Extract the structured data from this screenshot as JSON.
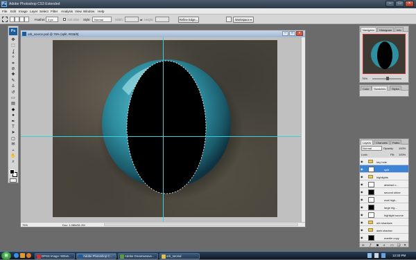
{
  "window": {
    "title": "Adobe Photoshop CS3 Extended",
    "logo": "Ps"
  },
  "menu": [
    "File",
    "Edit",
    "Image",
    "Layer",
    "Select",
    "Filter",
    "Analysis",
    "View",
    "Window",
    "Help"
  ],
  "options": {
    "feather_label": "Feather:",
    "feather_value": "0 px",
    "antialias_label": "Anti-alias",
    "style_label": "Style:",
    "style_value": "Normal",
    "width_label": "Width:",
    "height_label": "Height:",
    "refine_edge": "Refine Edge...",
    "workspace": "Workspace"
  },
  "tools_logo": "Ps",
  "document": {
    "title": "orb_source.psd @ 75% (split, RGB/8)",
    "zoom": "75%",
    "doc_size": "Doc: 1.08M/61.2M"
  },
  "navigator": {
    "tabs": [
      "Navigator",
      "Histogram",
      "Info"
    ],
    "zoom": "75%"
  },
  "color_panel": {
    "tabs": [
      "Color",
      "Swatches",
      "Styles"
    ]
  },
  "layers_panel": {
    "tabs": [
      "Layers",
      "Channels",
      "Paths"
    ],
    "blend_mode": "Normal",
    "opacity_label": "Opacity:",
    "opacity_value": "100%",
    "lock_label": "Lock:",
    "fill_label": "Fill:",
    "fill_value": "100%",
    "layers": [
      {
        "name": "key hole",
        "type": "group"
      },
      {
        "name": "split",
        "type": "layer",
        "selected": true
      },
      {
        "name": "highlights",
        "type": "group"
      },
      {
        "name": "abstract c...",
        "type": "layer"
      },
      {
        "name": "second shine",
        "type": "layer"
      },
      {
        "name": "oval high...",
        "type": "layer"
      },
      {
        "name": "large hig...",
        "type": "layer"
      },
      {
        "name": "highlight source",
        "type": "layer"
      },
      {
        "name": "orb shadows",
        "type": "group"
      },
      {
        "name": "dark shadow",
        "type": "group"
      },
      {
        "name": "marble copy",
        "type": "layer"
      }
    ]
  },
  "taskbar": {
    "items": [
      "DPSS Image: 900x6...",
      "Adobe Photoshop C...",
      "Adobe Dreamweave...",
      "orb_tutorial"
    ],
    "clock": "12:33 PM"
  },
  "colors": {
    "accent": "#3b84d8",
    "guide": "#32d2e0",
    "orb": "#3aa7b6"
  }
}
